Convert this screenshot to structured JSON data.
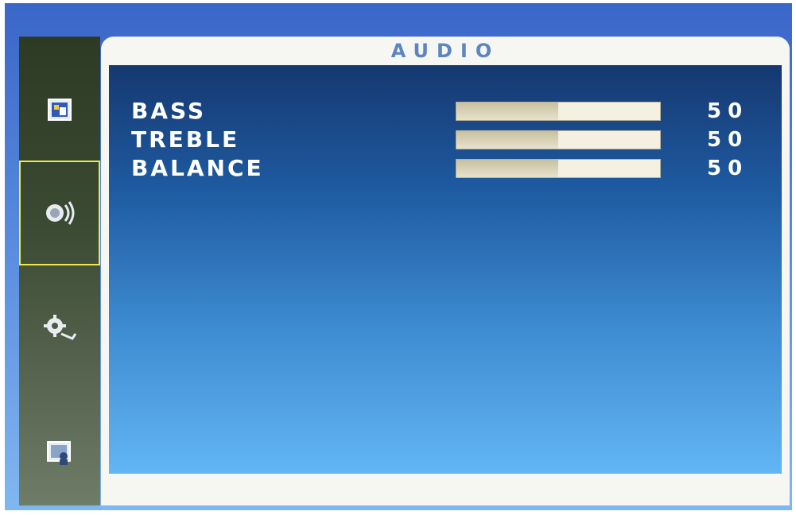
{
  "menu": {
    "title": "AUDIO",
    "items": [
      {
        "label": "BASS",
        "value": "50",
        "level": 0.5
      },
      {
        "label": "TREBLE",
        "value": "50",
        "level": 0.5
      },
      {
        "label": "BALANCE",
        "value": "50",
        "level": 0.5
      }
    ]
  },
  "sidebar": {
    "icons": [
      "picture-icon",
      "audio-speaker-icon",
      "settings-gear-icon",
      "display-person-icon"
    ],
    "selected": "audio-speaker-icon"
  },
  "colors": {
    "title": "#5b86c2",
    "selection_border": "#f0e84a",
    "content_top": "#163870",
    "content_bottom": "#62b6f4"
  }
}
